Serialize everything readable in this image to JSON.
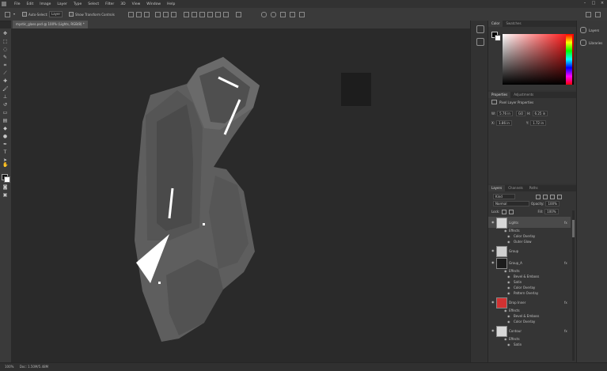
{
  "menubar": {
    "items": [
      "File",
      "Edit",
      "Image",
      "Layer",
      "Type",
      "Select",
      "Filter",
      "3D",
      "View",
      "Window",
      "Help"
    ]
  },
  "options": {
    "auto_select_label": "Auto-Select:",
    "auto_select_value": "Layer",
    "transform_label": "Show Transform Controls"
  },
  "document": {
    "tab_title": "mystic_glass.psd @ 100% (Lights, RGB/8) *"
  },
  "panels": {
    "color_tabs": [
      "Color",
      "Swatches"
    ],
    "properties_tabs": [
      "Properties",
      "Adjustments"
    ],
    "properties_title": "Pixel Layer Properties",
    "props": {
      "w_label": "W:",
      "w_value": "5.76 in",
      "h_label": "H:",
      "h_value": "6.25 in",
      "x_label": "X:",
      "x_value": "1.86 in",
      "y_label": "Y:",
      "y_value": "1.72 in",
      "link_label": "GO"
    },
    "layers_tabs": [
      "Layers",
      "Channels",
      "Paths"
    ]
  },
  "layers": {
    "kind_label": "Kind",
    "blend_mode": "Normal",
    "opacity_label": "Opacity:",
    "opacity_value": "100%",
    "lock_label": "Lock:",
    "fill_label": "Fill:",
    "fill_value": "100%",
    "rows": [
      {
        "name": "Lights",
        "kind": "layer",
        "fx": "fx",
        "thumb": "#d8d8d8"
      },
      {
        "name": "Effects",
        "kind": "effects"
      },
      {
        "name": "Color Overlay",
        "kind": "effect"
      },
      {
        "name": "Outer Glow",
        "kind": "effect"
      },
      {
        "name": "Group",
        "kind": "layer",
        "fx": "",
        "thumb": "#cfcfcf"
      },
      {
        "name": "Group_A",
        "kind": "layer",
        "fx": "fx",
        "thumb": "#1c1c1c"
      },
      {
        "name": "Effects",
        "kind": "effects"
      },
      {
        "name": "Bevel & Emboss",
        "kind": "effect"
      },
      {
        "name": "Satin",
        "kind": "effect"
      },
      {
        "name": "Color Overlay",
        "kind": "effect"
      },
      {
        "name": "Pattern Overlay",
        "kind": "effect"
      },
      {
        "name": "Drop Inner",
        "kind": "layer",
        "fx": "fx",
        "thumb": "#d23232"
      },
      {
        "name": "Effects",
        "kind": "effects"
      },
      {
        "name": "Bevel & Emboss",
        "kind": "effect"
      },
      {
        "name": "Color Overlay",
        "kind": "effect"
      },
      {
        "name": "Contour",
        "kind": "layer",
        "fx": "fx",
        "thumb": "#d8d8d8"
      },
      {
        "name": "Effects",
        "kind": "effects"
      },
      {
        "name": "Satin",
        "kind": "effect"
      }
    ]
  },
  "far_right": {
    "items": [
      "Layers",
      "Libraries"
    ]
  },
  "status": {
    "zoom": "100%",
    "doc_info": "Doc: 1.50M/5.48M"
  },
  "colors": {
    "canvas_bg": "#2a2a2a",
    "shape_main": "#5e5e5e",
    "shape_light": "#6a6a6a",
    "shape_dark": "#4c4c4c",
    "highlight": "#ffffff",
    "swatch_square": "#1d1d1d"
  }
}
